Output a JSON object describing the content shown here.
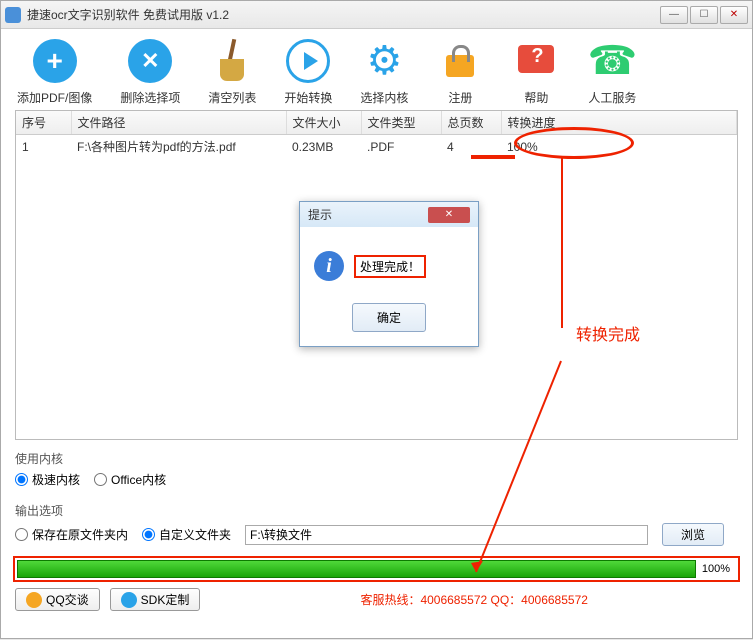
{
  "window": {
    "title": "捷速ocr文字识别软件 免费试用版 v1.2"
  },
  "toolbar": {
    "add": "添加PDF/图像",
    "delete": "删除选择项",
    "clear": "清空列表",
    "start": "开始转换",
    "kernel": "选择内核",
    "register": "注册",
    "help": "帮助",
    "service": "人工服务"
  },
  "columns": {
    "seq": "序号",
    "path": "文件路径",
    "size": "文件大小",
    "type": "文件类型",
    "pages": "总页数",
    "progress": "转换进度"
  },
  "row": {
    "seq": "1",
    "path": "F:\\各种图片转为pdf的方法.pdf",
    "size": "0.23MB",
    "type": ".PDF",
    "pages": "4",
    "progress": "100%"
  },
  "dialog": {
    "title": "提示",
    "message": "处理完成！",
    "ok": "确定"
  },
  "annotation": {
    "done": "转换完成"
  },
  "kernel_section": {
    "label": "使用内核",
    "fast": "极速内核",
    "office": "Office内核"
  },
  "output_section": {
    "label": "输出选项",
    "original": "保存在原文件夹内",
    "custom": "自定义文件夹",
    "path": "F:\\转换文件",
    "browse": "浏览"
  },
  "progress": {
    "text": "100%"
  },
  "footer": {
    "qq": "QQ交谈",
    "sdk": "SDK定制",
    "hotline": "客服热线：4006685572 QQ：4006685572"
  }
}
